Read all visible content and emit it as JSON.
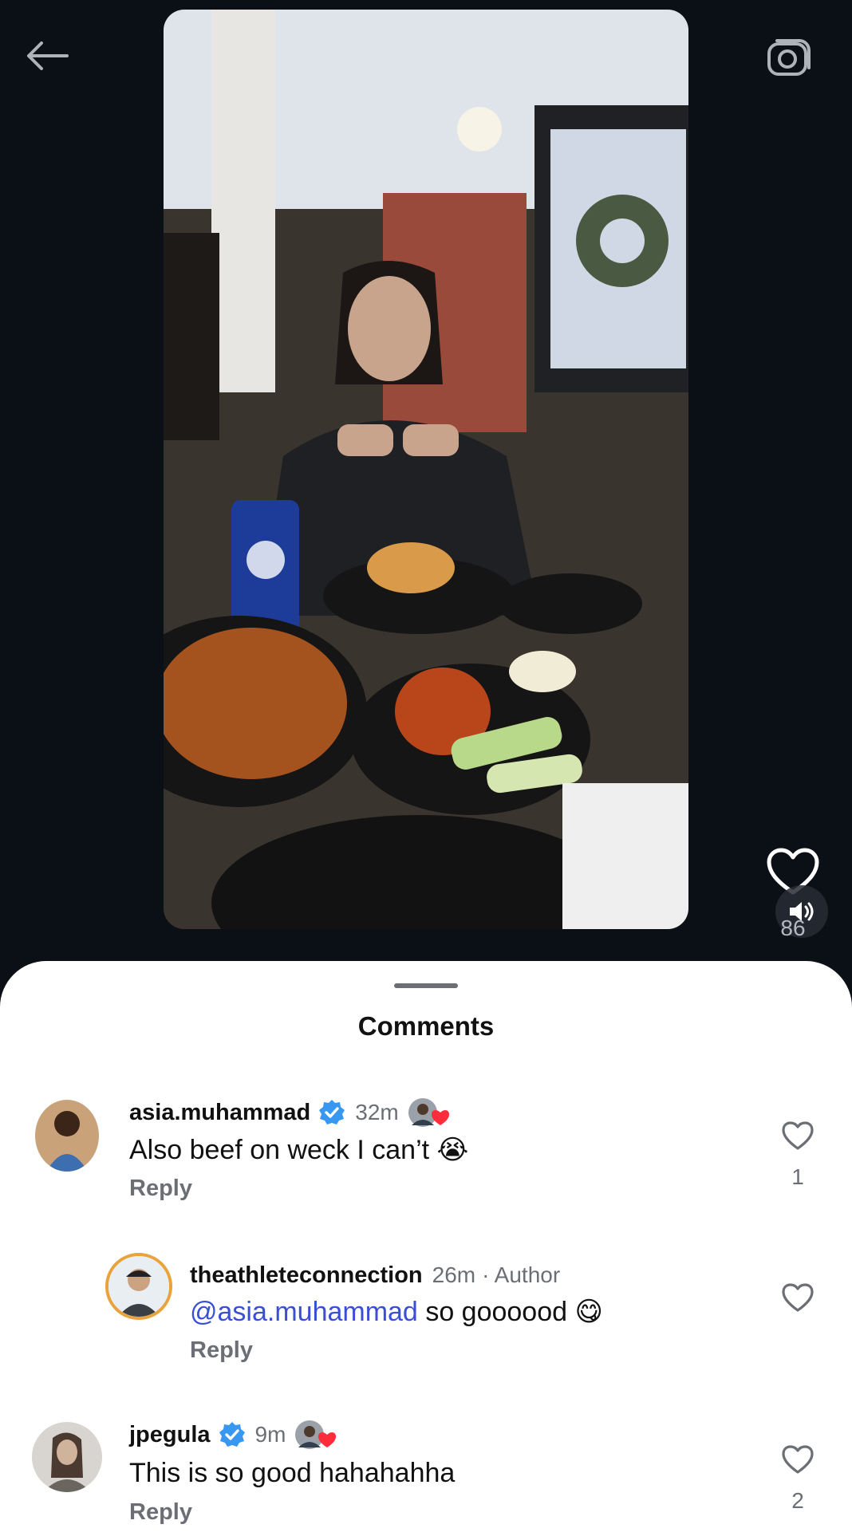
{
  "overlay": {
    "like_count": "86",
    "icons": {
      "back": "arrow-left-icon",
      "camera": "camera-icon",
      "like": "heart-outline-icon",
      "sound": "speaker-icon"
    }
  },
  "sheet": {
    "title": "Comments"
  },
  "comments": [
    {
      "username": "asia.muhammad",
      "verified": true,
      "time": "32m",
      "text": "Also beef on weck I can’t 😭",
      "reply_label": "Reply",
      "like_count": "1",
      "liked_by_author": true
    },
    {
      "username": "theathleteconnection",
      "verified": false,
      "time": "26m",
      "author_tag": "· Author",
      "mention": "@asia.muhammad",
      "text": "so goooood 😋",
      "reply_label": "Reply",
      "like_count": ""
    },
    {
      "username": "jpegula",
      "verified": true,
      "time": "9m",
      "text": "This is so good hahahahha",
      "reply_label": "Reply",
      "like_count": "2",
      "liked_by_author": true
    }
  ],
  "colors": {
    "background": "#0b0f16",
    "sheet": "#ffffff",
    "verified_blue": "#3897f0",
    "mention_blue": "#3a4fd6",
    "muted_text": "#6b6f75",
    "heart_red": "#ff2d3c"
  }
}
